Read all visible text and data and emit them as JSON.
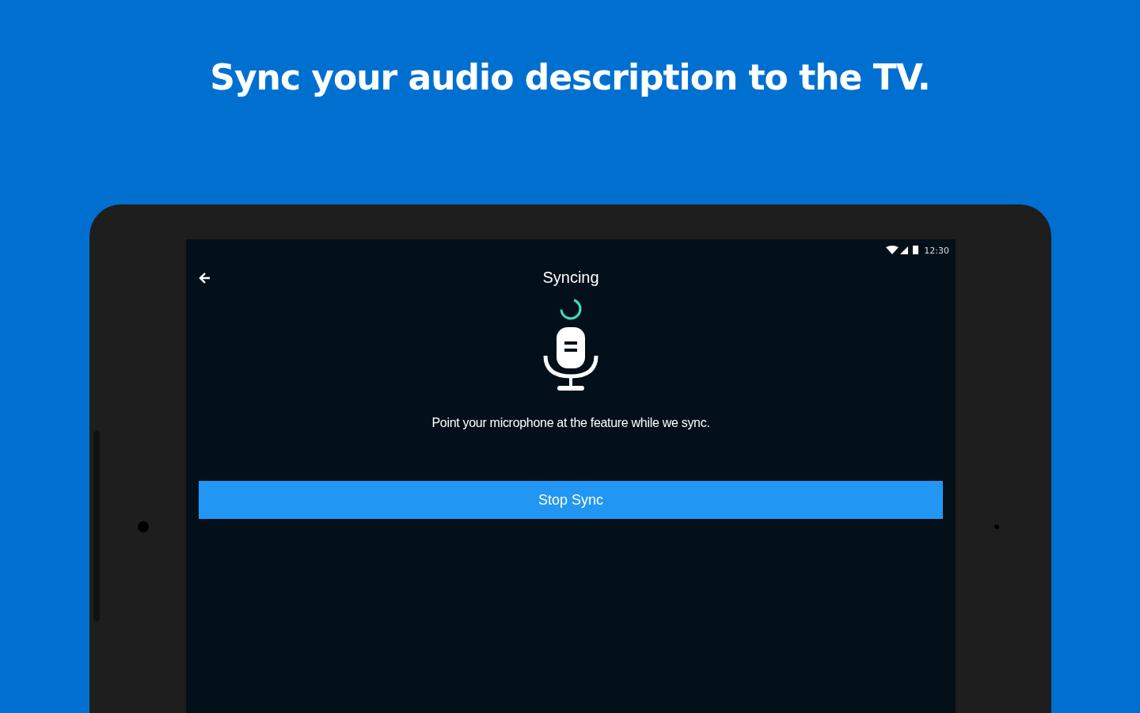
{
  "headline": "Sync your audio description to the TV.",
  "status_bar": {
    "time": "12:30"
  },
  "app_bar": {
    "title": "Syncing"
  },
  "instruction": "Point your microphone at the feature while we sync.",
  "button": {
    "label": "Stop Sync"
  }
}
